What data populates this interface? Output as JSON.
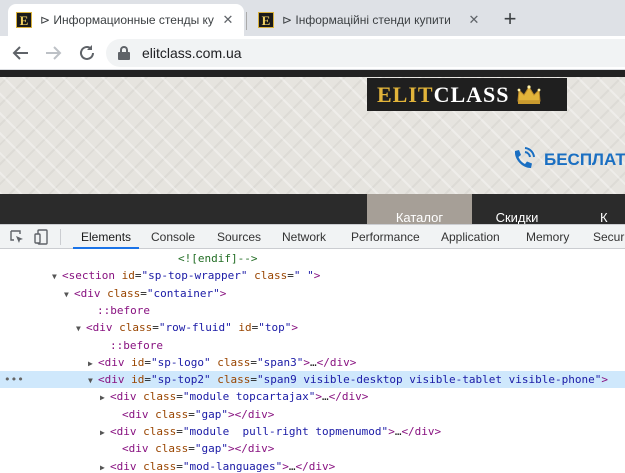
{
  "browser": {
    "tabs": [
      {
        "title": "⊳ Информационные стенды купить",
        "favicon": "E",
        "active": true
      },
      {
        "title": "⊳ Інформаційні стенди купити",
        "favicon": "E",
        "active": false
      }
    ],
    "tab_close": "✕",
    "new_tab": "+",
    "url": "elitclass.com.ua"
  },
  "site": {
    "logo_elit": "ELIT",
    "logo_class": "CLASS",
    "phone_text": "БЕСПЛАТ",
    "menu": [
      "Каталог",
      "Скидки",
      "К"
    ]
  },
  "devtools": {
    "tabs": [
      "Elements",
      "Console",
      "Sources",
      "Network",
      "Performance",
      "Application",
      "Memory",
      "Securi"
    ],
    "active_tab": "Elements"
  },
  "dom_lines": [
    {
      "text": "<![endif]-->"
    },
    {
      "tag": "section",
      "id": "sp-top-wrapper",
      "class": "\" \""
    },
    {
      "tag": "div",
      "class": "container"
    },
    {
      "pseudo": "::before"
    },
    {
      "tag": "div",
      "class": "row-fluid",
      "id": "top"
    },
    {
      "pseudo": "::before"
    },
    {
      "tag": "div",
      "id": "sp-logo",
      "class": "span3",
      "collapsed": "…</div>"
    },
    {
      "tag": "div",
      "id": "sp-top2",
      "class": "span9 visible-desktop visible-tablet visible-phone"
    },
    {
      "tag": "div",
      "class": "module topcartajax",
      "collapsed": "…</div>"
    },
    {
      "tag": "div",
      "class": "gap",
      "closed": "</div>"
    },
    {
      "tag": "div",
      "class": "module  pull-right topmenumod",
      "collapsed": "…</div>"
    },
    {
      "tag": "div",
      "class": "gap",
      "closed": "</div>"
    },
    {
      "tag": "div",
      "class": "mod-languages",
      "collapsed": "…</div>"
    }
  ],
  "colors": {
    "accent": "#1a73e8",
    "selection": "#cfe8fc",
    "logo_gold": "#e2b43a",
    "phone_blue": "#1a6fc2"
  }
}
